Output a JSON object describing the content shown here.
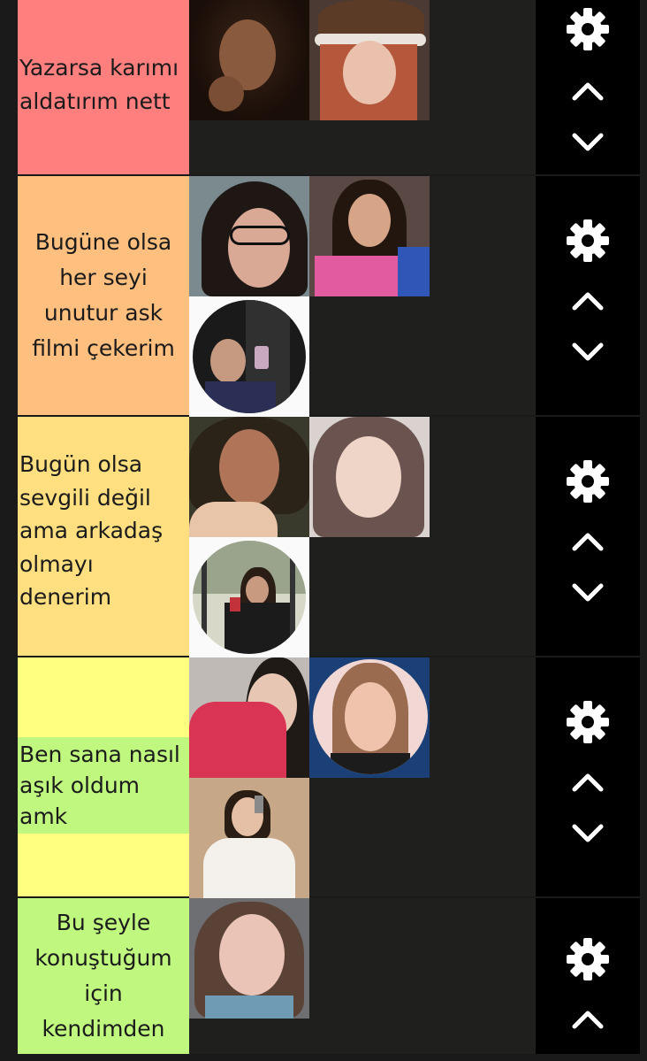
{
  "colors": {
    "background": "#1a1a1a",
    "tier_colors": [
      "#ff7f7f",
      "#ffbf7f",
      "#ffdf80",
      "#ffff7f",
      "#bff77f"
    ],
    "controls_background": "#000000",
    "icon_color": "#ffffff"
  },
  "icons": {
    "settings": "gear-icon",
    "move_up": "chevron-up-icon",
    "move_down": "chevron-down-icon"
  },
  "tiers": [
    {
      "label": "Yazarsa karımı\naldatırım nett",
      "items": [
        {
          "name": "tier-item-photo"
        },
        {
          "name": "tier-item-photo"
        }
      ]
    },
    {
      "label": "Bugüne olsa\nher seyi\nunutur ask\nfilmi çekerim",
      "items": [
        {
          "name": "tier-item-photo"
        },
        {
          "name": "tier-item-photo"
        },
        {
          "name": "tier-item-photo"
        }
      ]
    },
    {
      "label": "Bugün olsa\nsevgili değil\nama arkadaş\nolmayı\ndenerim",
      "items": [
        {
          "name": "tier-item-photo"
        },
        {
          "name": "tier-item-photo"
        },
        {
          "name": "tier-item-photo"
        }
      ]
    },
    {
      "label": "Ben sana nasıl\naşık oldum\namk",
      "items": [
        {
          "name": "tier-item-photo"
        },
        {
          "name": "tier-item-photo"
        },
        {
          "name": "tier-item-photo"
        }
      ]
    },
    {
      "label": "Bu şeyle\nkonuştuğum\niçin\nkendimden",
      "items": [
        {
          "name": "tier-item-photo"
        }
      ]
    }
  ]
}
